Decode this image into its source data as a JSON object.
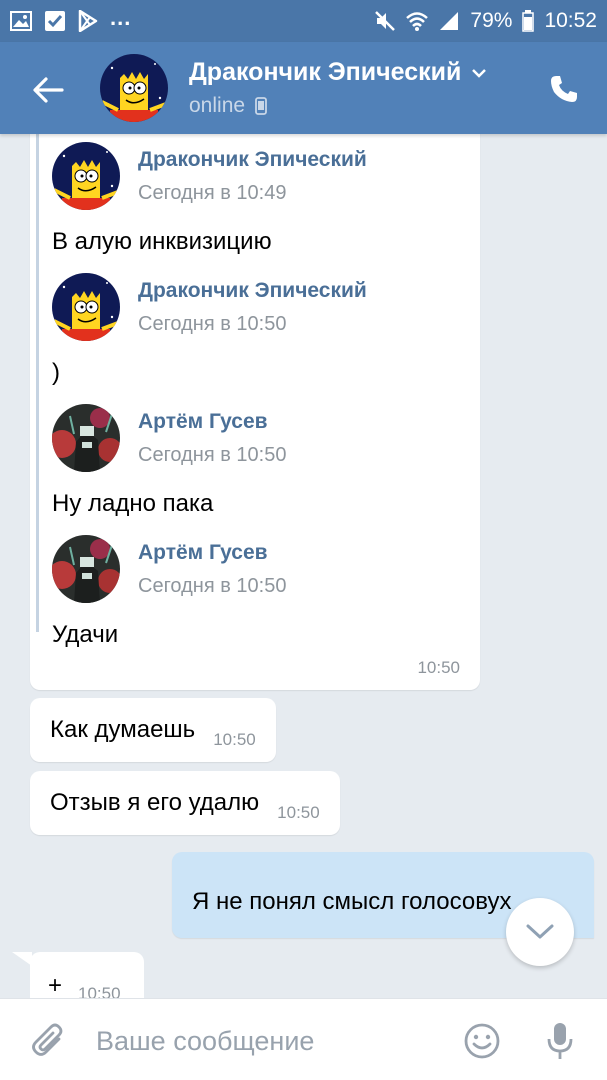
{
  "status_bar": {
    "battery": "79%",
    "time": "10:52",
    "more": "..."
  },
  "header": {
    "title": "Дракончик Эпический",
    "status": "online"
  },
  "forwarded": [
    {
      "name": "Дракончик Эпический",
      "date": "Сегодня в 10:49",
      "text": "В алую инквизицию",
      "avatar": "bart"
    },
    {
      "name": "Дракончик Эпический",
      "date": "Сегодня в 10:50",
      "text": ")",
      "avatar": "bart"
    },
    {
      "name": "Артём Гусев",
      "date": "Сегодня в 10:50",
      "text": "Ну ладно пака",
      "avatar": "dark"
    },
    {
      "name": "Артём Гусев",
      "date": "Сегодня в 10:50",
      "text": "Удачи",
      "avatar": "dark"
    }
  ],
  "forward_time": "10:50",
  "messages": [
    {
      "text": "Как думаешь",
      "time": "10:50"
    },
    {
      "text": "Отзыв я его удалю",
      "time": "10:50"
    }
  ],
  "outgoing": {
    "text": "Я не понял смысл голосовух"
  },
  "last": {
    "text": "+",
    "time": "10:50"
  },
  "composer": {
    "placeholder": "Ваше сообщение"
  },
  "colors": {
    "header": "#5181b8",
    "statusbar": "#4a76a8",
    "background": "#e6ebf0",
    "outgoing": "#cce4f7",
    "name": "#4a6f97"
  }
}
